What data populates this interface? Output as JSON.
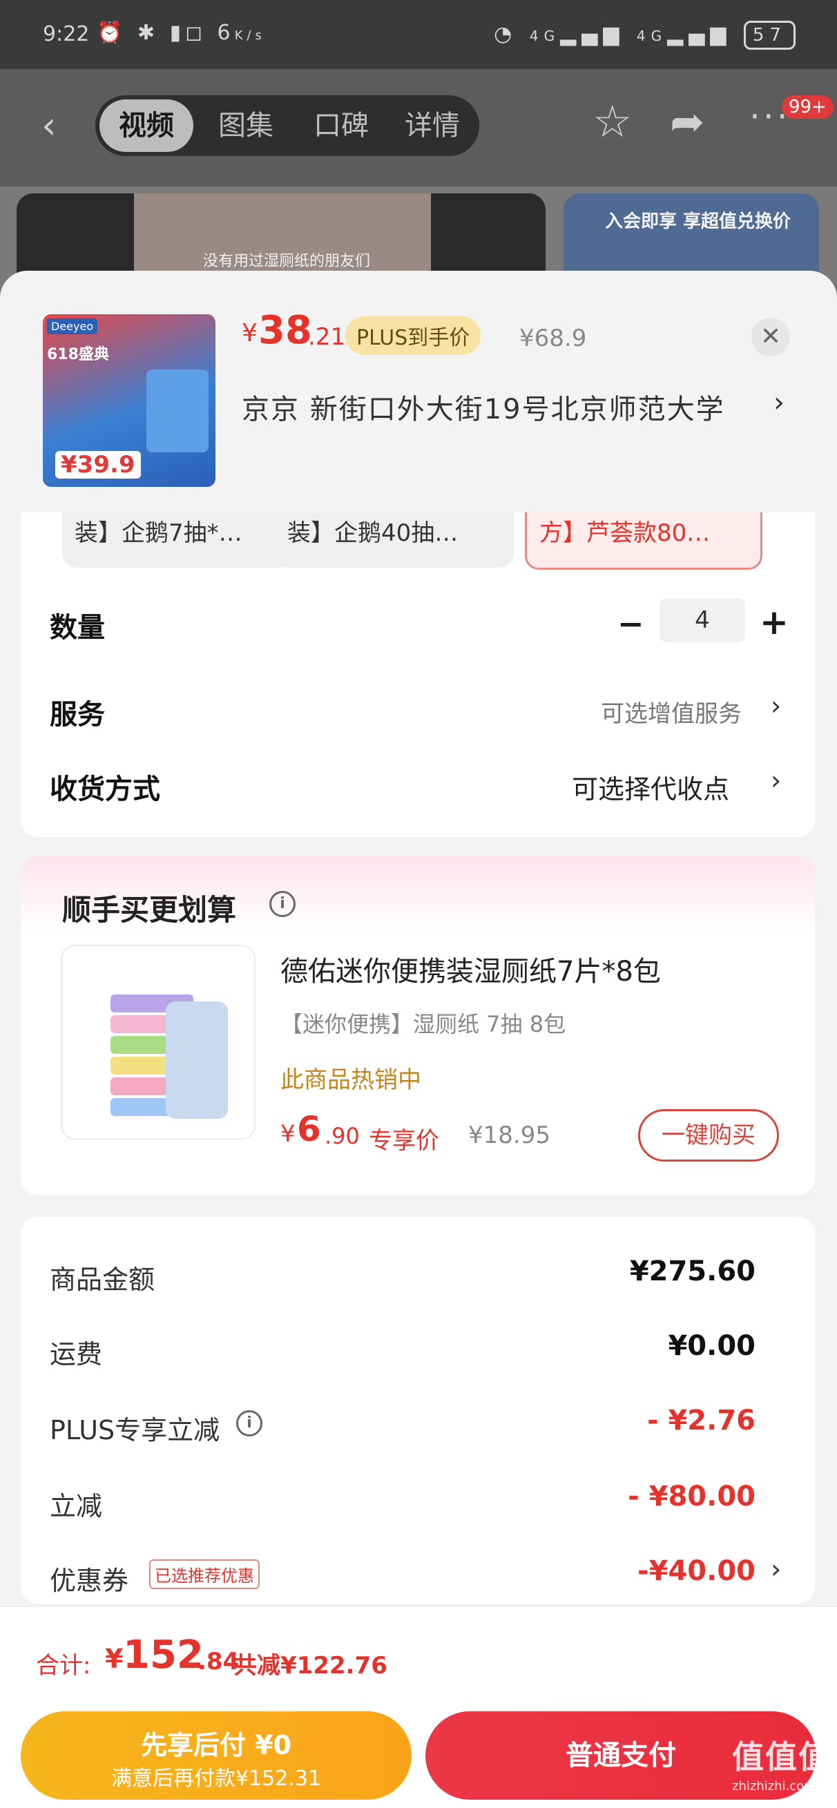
{
  "status_bar": {
    "time": "9:22",
    "speed_top": "6",
    "speed_unit": "K/s",
    "network1": "4G",
    "network2": "4G",
    "battery": "57"
  },
  "top_nav": {
    "tabs": [
      {
        "label": "视频"
      },
      {
        "label": "图集"
      },
      {
        "label": "口碑"
      },
      {
        "label": "详情"
      }
    ],
    "active_tab": "视频",
    "badge": "99+"
  },
  "video_caption": "没有用过湿厕纸的朋友们",
  "promo_banner": "入会即享 享超值兑换价",
  "product": {
    "thumb_brand": "Deeyeo",
    "thumb_promo": "618盛典",
    "thumb_price": "39.9",
    "price_symbol": "¥",
    "price_int": "38",
    "price_dec": ".21",
    "plus_tag": "PLUS到手价",
    "original_price": "¥68.9",
    "address": "京京   新街口外大街19号北京师范大学"
  },
  "variants": [
    {
      "label": "装】企鹅7抽*…",
      "selected": false
    },
    {
      "label": "装】企鹅40抽…",
      "selected": false
    },
    {
      "label": "方】芦荟款80…",
      "selected": true
    }
  ],
  "quantity": {
    "label": "数量",
    "value": "4"
  },
  "service": {
    "label": "服务",
    "value": "可选增值服务"
  },
  "delivery": {
    "label": "收货方式",
    "value": "可选择代收点"
  },
  "addon": {
    "title": "顺手买更划算",
    "item_title": "德佑迷你便携装湿厕纸7片*8包",
    "item_sub": "【迷你便携】湿厕纸 7抽 8包",
    "hot": "此商品热销中",
    "price_symbol": "¥",
    "price_int": "6",
    "price_dec": ".90",
    "price_label": "专享价",
    "original": "¥18.95",
    "buy_button": "一键购买"
  },
  "summary": {
    "rows": [
      {
        "label": "商品金额",
        "value": "¥275.60"
      },
      {
        "label": "运费",
        "value": "¥0.00"
      },
      {
        "label": "PLUS专享立减",
        "value": "- ¥2.76"
      },
      {
        "label": "立减",
        "value": "- ¥80.00"
      },
      {
        "label": "优惠券",
        "tag": "已选推荐优惠",
        "value": "-¥40.00"
      }
    ]
  },
  "footer": {
    "total_label": "合计:",
    "total_symbol": "¥",
    "total_int": "152",
    "total_dec": ".84",
    "saved": "共减¥122.76",
    "pay_later_line1": "先享后付 ¥0",
    "pay_later_line2": "满意后再付款¥152.31",
    "pay_button": "普通支付"
  },
  "watermark": {
    "text": "值值值",
    "domain": "zhizhizhi.com"
  }
}
